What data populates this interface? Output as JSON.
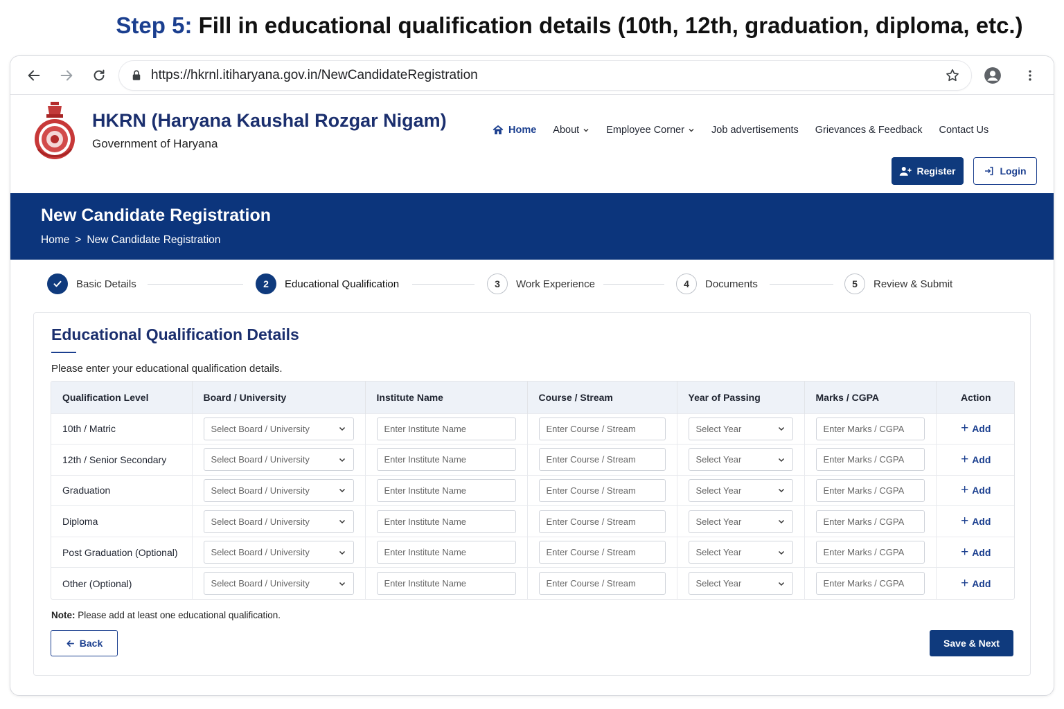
{
  "caption": {
    "step": "Step 5:",
    "text": "Fill in educational qualification details (10th, 12th, graduation, diploma, etc.)"
  },
  "browser": {
    "url": "https://hkrnl.itiharyana.gov.in/NewCandidateRegistration"
  },
  "header": {
    "org_title": "HKRN (Haryana Kaushal Rozgar Nigam)",
    "org_subtitle": "Government of Haryana",
    "nav": [
      "Home",
      "About",
      "Employee Corner",
      "Job advertisements",
      "Grievances & Feedback",
      "Contact Us"
    ],
    "register_label": "Register",
    "login_label": "Login"
  },
  "banner": {
    "title": "New Candidate Registration",
    "crumb_home": "Home",
    "crumb_sep": ">",
    "crumb_current": "New Candidate Registration"
  },
  "stepper": [
    {
      "num": "",
      "label": "Basic Details",
      "state": "done"
    },
    {
      "num": "2",
      "label": "Educational Qualification",
      "state": "current"
    },
    {
      "num": "3",
      "label": "Work Experience",
      "state": "todo"
    },
    {
      "num": "4",
      "label": "Documents",
      "state": "todo"
    },
    {
      "num": "5",
      "label": "Review & Submit",
      "state": "todo"
    }
  ],
  "form": {
    "title": "Educational Qualification Details",
    "intro": "Please enter your educational qualification details.",
    "columns": [
      "Qualification Level",
      "Board / University",
      "Institute Name",
      "Course / Stream",
      "Year of Passing",
      "Marks / CGPA",
      "Action"
    ],
    "rows": [
      {
        "level": "10th / Matric"
      },
      {
        "level": "12th / Senior Secondary"
      },
      {
        "level": "Graduation"
      },
      {
        "level": "Diploma"
      },
      {
        "level": "Post Graduation (Optional)"
      },
      {
        "level": "Other (Optional)"
      }
    ],
    "board_placeholder": "Select Board / University",
    "institute_placeholder": "Enter Institute Name",
    "course_placeholder": "Enter Course / Stream",
    "year_placeholder": "Select Year",
    "marks_placeholder": "Enter Marks / CGPA",
    "add_label": "Add",
    "note_label": "Note:",
    "note_text": "Please add at least one educational qualification.",
    "back_label": "Back",
    "save_label": "Save & Next"
  }
}
